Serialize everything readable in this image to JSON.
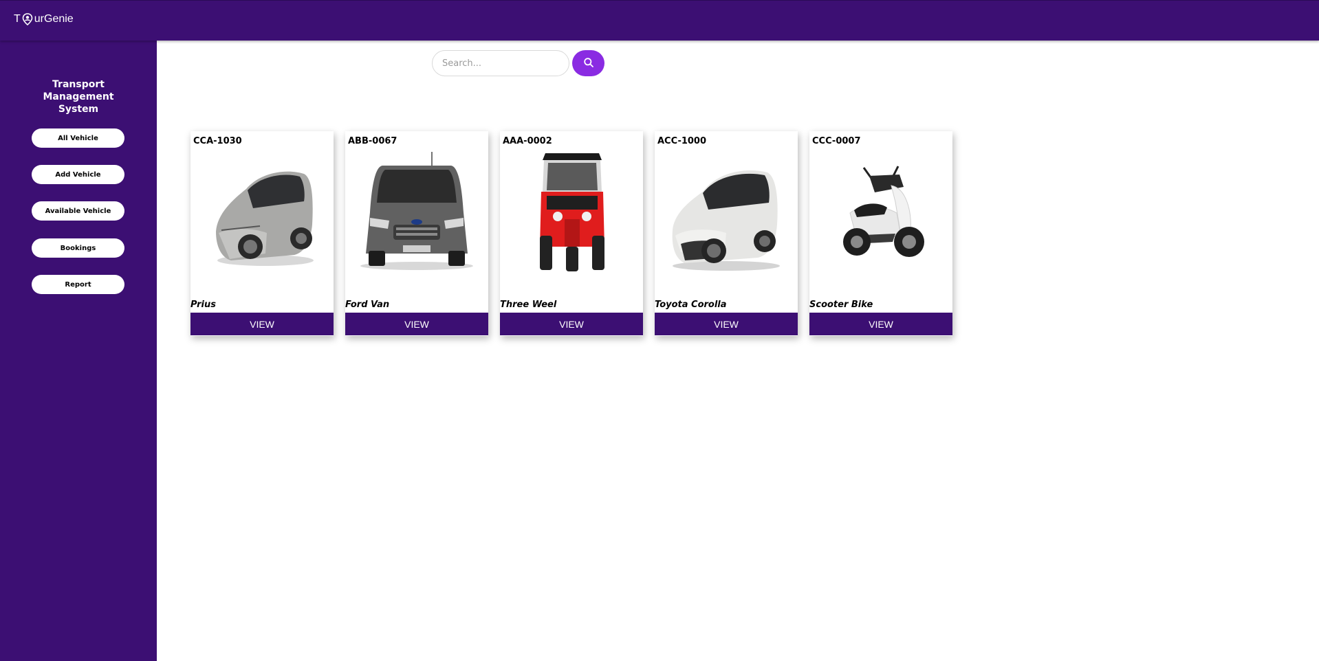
{
  "header": {
    "brand_left": "T",
    "brand_right": "urGenie",
    "brand_icon": "location-pin-icon"
  },
  "sidebar": {
    "title": "Transport Management System",
    "items": [
      {
        "label": "All Vehicle"
      },
      {
        "label": "Add Vehicle"
      },
      {
        "label": "Available Vehicle"
      },
      {
        "label": "Bookings"
      },
      {
        "label": "Report"
      }
    ]
  },
  "search": {
    "placeholder": "Search...",
    "value": "",
    "icon": "search-icon"
  },
  "vehicles": [
    {
      "code": "CCA-1030",
      "name": "Prius",
      "image": "silver-sedan",
      "view_label": "VIEW"
    },
    {
      "code": "ABB-0067",
      "name": "Ford Van",
      "image": "grey-van",
      "view_label": "VIEW"
    },
    {
      "code": "AAA-0002",
      "name": "Three Weel",
      "image": "red-three-wheeler",
      "view_label": "VIEW"
    },
    {
      "code": "ACC-1000",
      "name": "Toyota Corolla",
      "image": "white-sedan",
      "view_label": "VIEW"
    },
    {
      "code": "CCC-0007",
      "name": "Scooter Bike",
      "image": "white-scooter",
      "view_label": "VIEW"
    }
  ],
  "colors": {
    "primary": "#3c0f73",
    "accent": "#8a2be2",
    "background": "#ffffff"
  }
}
